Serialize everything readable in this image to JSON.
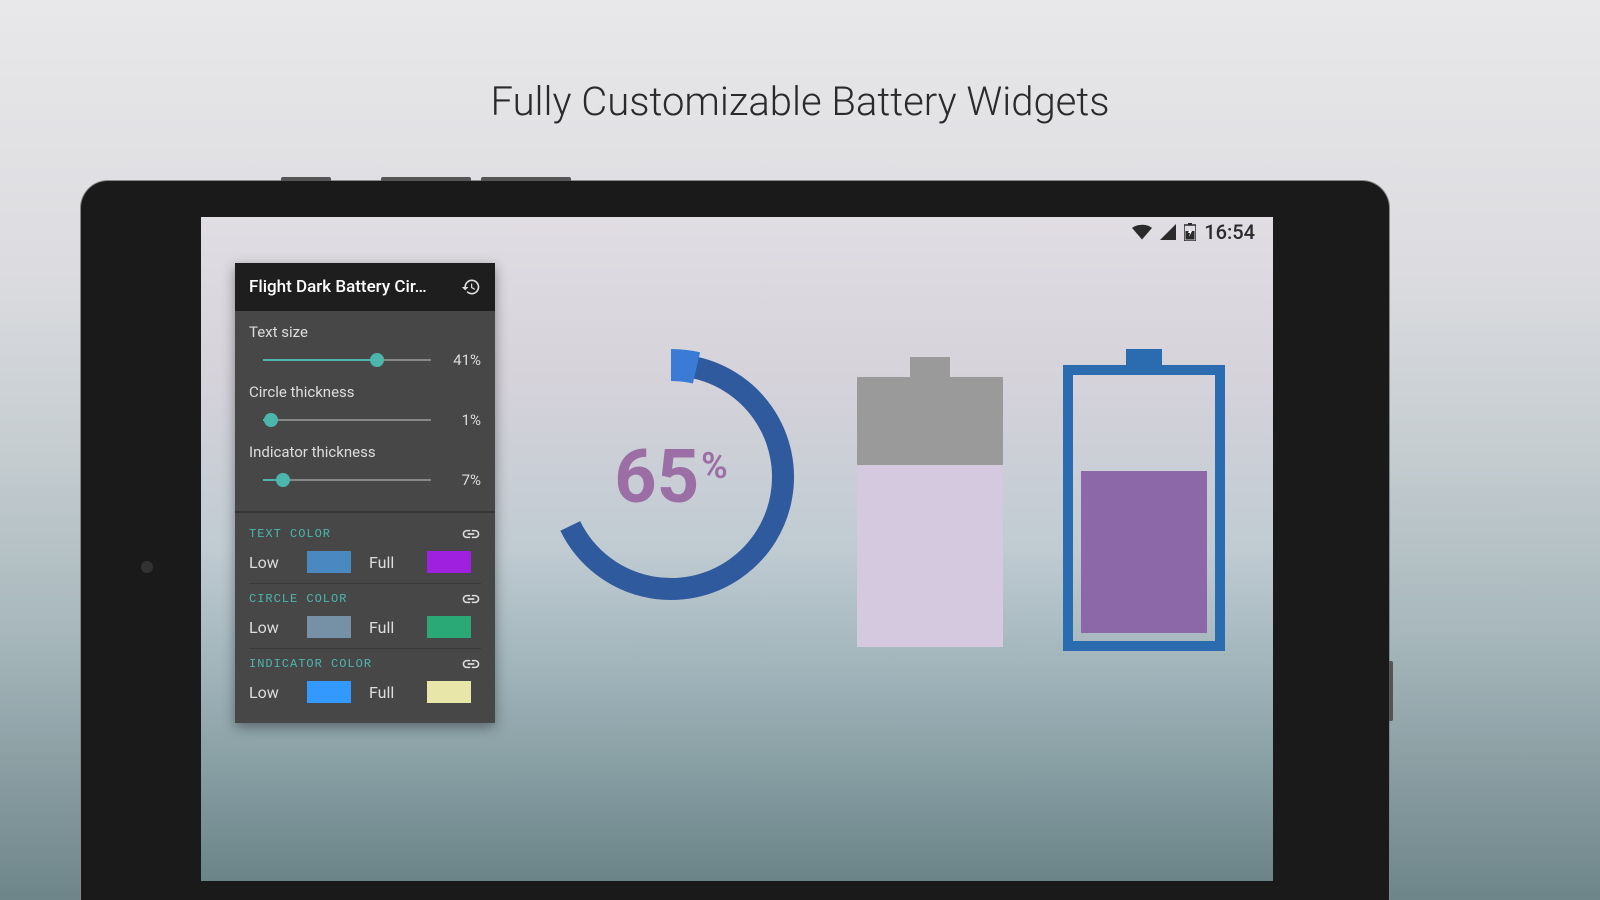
{
  "page": {
    "title": "Fully Customizable Battery Widgets"
  },
  "status_bar": {
    "time": "16:54"
  },
  "panel": {
    "title": "Flight Dark Battery Cir…",
    "sliders": [
      {
        "label": "Text size",
        "value": 41,
        "display": "41%"
      },
      {
        "label": "Circle thickness",
        "value": 1,
        "display": "1%"
      },
      {
        "label": "Indicator thickness",
        "value": 7,
        "display": "7%"
      }
    ],
    "color_sections": [
      {
        "heading": "TEXT COLOR",
        "low_label": "Low",
        "low_color": "#4a88c2",
        "full_label": "Full",
        "full_color": "#a020e0"
      },
      {
        "heading": "CIRCLE COLOR",
        "low_label": "Low",
        "low_color": "#7690a5",
        "full_label": "Full",
        "full_color": "#2aa876"
      },
      {
        "heading": "INDICATOR COLOR",
        "low_label": "Low",
        "low_color": "#3399ff",
        "full_label": "Full",
        "full_color": "#e8e6a8"
      }
    ]
  },
  "widgets": {
    "circle": {
      "percent": 65,
      "text_color": "#9b6fa6",
      "ring_color": "#2f5a9e",
      "indicator_color": "#3a7bd5"
    },
    "battery1": {
      "fill_percent": 67,
      "fill_color": "#d5c9e0",
      "empty_color": "#9a9a9a"
    },
    "battery2": {
      "fill_percent": 60,
      "border_color": "#2b6cb0",
      "fill_color": "#8d68a8"
    }
  }
}
